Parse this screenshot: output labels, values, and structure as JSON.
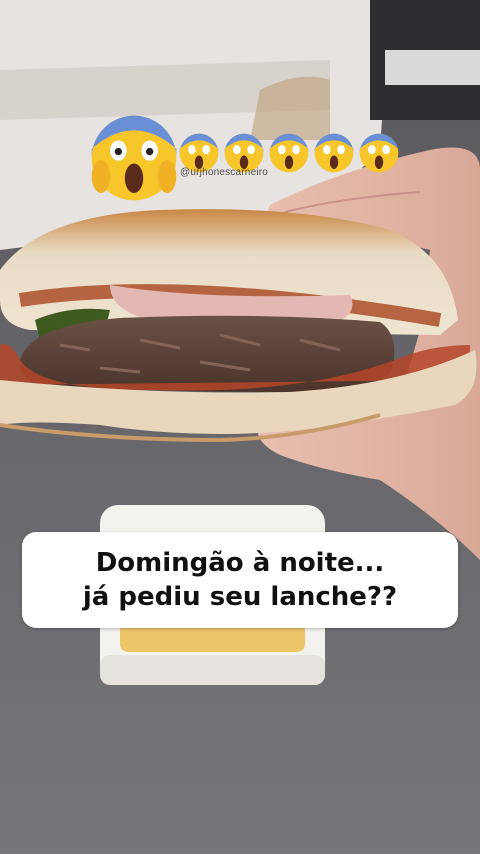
{
  "overlay": {
    "watermark": "@urjhonescarneiro",
    "caption_line1": "Domingão à noite...",
    "caption_line2": "já pediu seu lanche??",
    "emojis": [
      "screaming-face",
      "screaming-face",
      "screaming-face",
      "screaming-face",
      "screaming-face",
      "screaming-face"
    ]
  },
  "colors": {
    "caption_bg": "#ffffff",
    "caption_text": "#111111",
    "emoji_face": "#f7c62b"
  }
}
